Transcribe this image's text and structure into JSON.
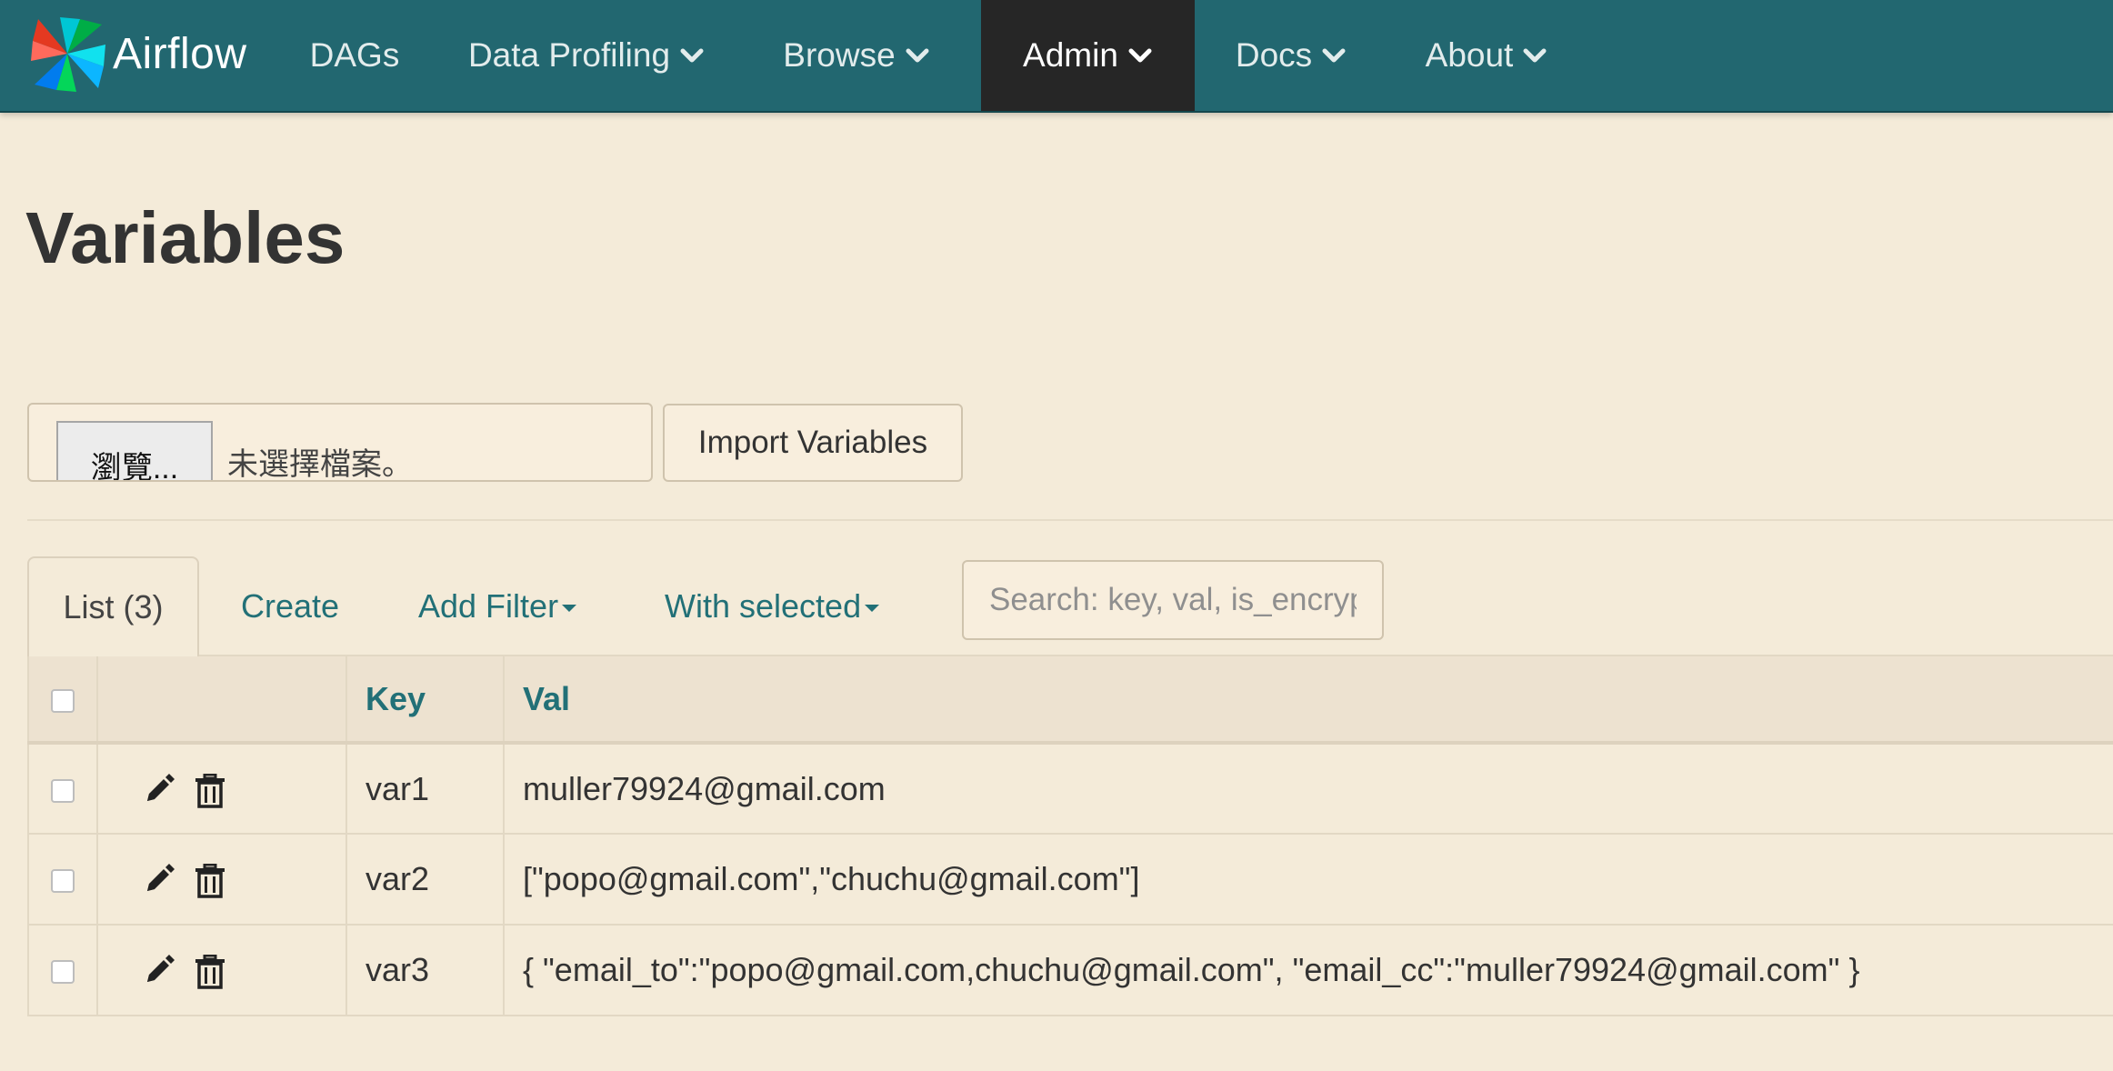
{
  "navbar": {
    "brand": "Airflow",
    "items": [
      {
        "label": "DAGs"
      },
      {
        "label": "Data Profiling"
      },
      {
        "label": "Browse"
      },
      {
        "label": "Admin"
      },
      {
        "label": "Docs"
      },
      {
        "label": "About"
      }
    ],
    "active_item": "Admin",
    "colors": {
      "background": "#226770",
      "active_background": "#262626"
    }
  },
  "page": {
    "title": "Variables",
    "background": "#f4ebd9"
  },
  "import_form": {
    "browse_label": "瀏覽...",
    "file_status": "未選擇檔案。",
    "import_button": "Import Variables"
  },
  "tabs": {
    "list_label": "List (3)",
    "create_label": "Create",
    "add_filter_label": "Add Filter",
    "with_selected_label": "With selected"
  },
  "search": {
    "placeholder": "Search: key, val, is_encrypted",
    "value": ""
  },
  "table": {
    "columns": [
      "Key",
      "Val"
    ],
    "rows": [
      {
        "key": "var1",
        "val": "muller79924@gmail.com"
      },
      {
        "key": "var2",
        "val": "[\"popo@gmail.com\",\"chuchu@gmail.com\"]"
      },
      {
        "key": "var3",
        "val": "{ \"email_to\":\"popo@gmail.com,chuchu@gmail.com\", \"email_cc\":\"muller79924@gmail.com\" }"
      }
    ],
    "row_actions": [
      "pencil-icon",
      "trash-icon"
    ],
    "header_color": "#227077"
  }
}
